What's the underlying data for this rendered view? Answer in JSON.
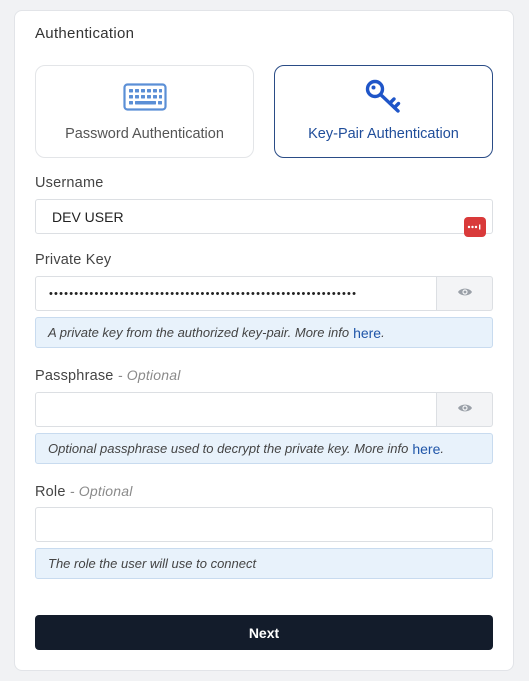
{
  "section_title": "Authentication",
  "auth_options": {
    "password": {
      "label": "Password Authentication",
      "icon": "keyboard-icon"
    },
    "keypair": {
      "label": "Key-Pair Authentication",
      "icon": "key-icon",
      "selected": true
    }
  },
  "username": {
    "label": "Username",
    "value": "DEV USER",
    "icon": "password-manager-icon"
  },
  "private_key": {
    "label": "Private Key",
    "masked_value": "•••••••••••••••••••••••••••••••••••••••••••••••••••••••••••••",
    "toggle_icon": "eye-icon",
    "help_text": "A private key from the authorized key-pair. More info",
    "help_link": "here",
    "help_tail": "."
  },
  "passphrase": {
    "label": "Passphrase",
    "optional": "- Optional",
    "value": "",
    "toggle_icon": "eye-icon",
    "help_text": "Optional passphrase used to decrypt the private key. More info",
    "help_link": "here",
    "help_tail": "."
  },
  "role": {
    "label": "Role",
    "optional": "- Optional",
    "value": "",
    "help_text": "The role the user will use to connect"
  },
  "next_label": "Next",
  "colors": {
    "accent": "#1f4d9a",
    "button_bg": "#131c2b",
    "help_bg": "#e8f2fb",
    "pw_manager": "#d93a3a"
  }
}
